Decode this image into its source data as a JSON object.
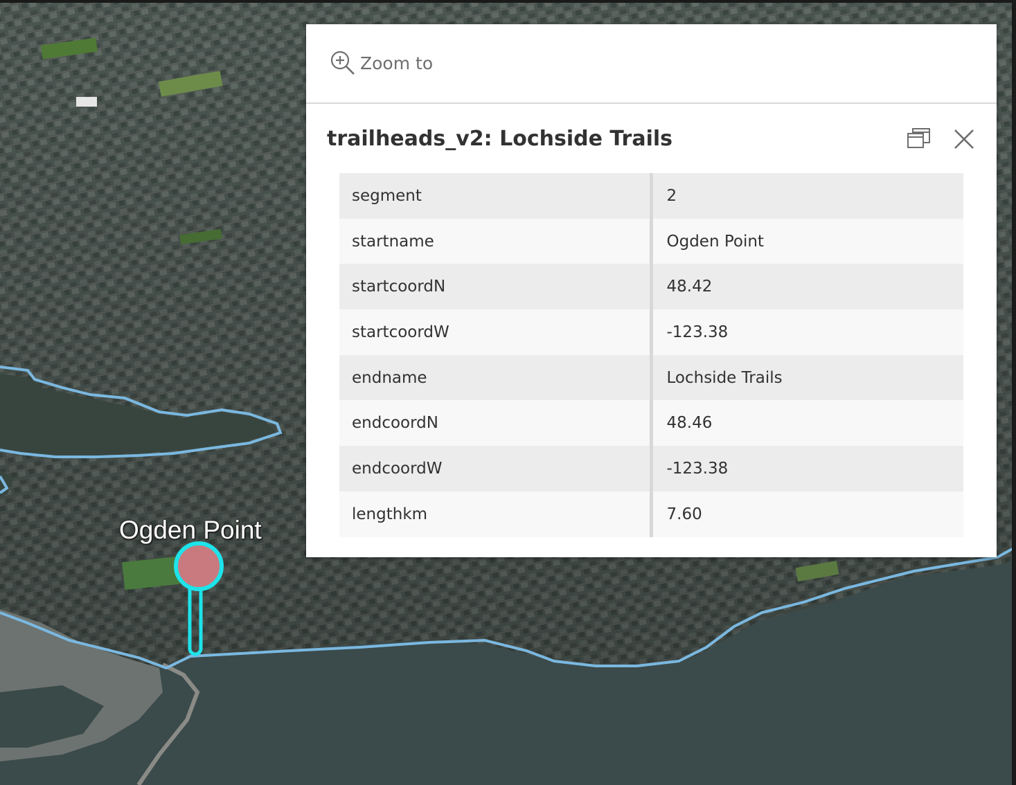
{
  "map": {
    "place_label": "Ogden Point",
    "colors": {
      "land": "#505c57",
      "water": "#3b4a4a",
      "trail": "#7ab8e0",
      "marker_fill": "#c97a7e",
      "marker_outline": "#1ee3ea"
    }
  },
  "popup": {
    "zoom_to_label": "Zoom to",
    "zoom_icon": "zoom-in-icon",
    "title": "trailheads_v2: Lochside Trails",
    "dock_icon": "dock-icon",
    "close_icon": "close-icon",
    "attributes": [
      {
        "field": "segment",
        "value": "2"
      },
      {
        "field": "startname",
        "value": "Ogden Point"
      },
      {
        "field": "startcoordN",
        "value": "48.42"
      },
      {
        "field": "startcoordW",
        "value": "-123.38"
      },
      {
        "field": "endname",
        "value": "Lochside Trails"
      },
      {
        "field": "endcoordN",
        "value": "48.46"
      },
      {
        "field": "endcoordW",
        "value": "-123.38"
      },
      {
        "field": "lengthkm",
        "value": "7.60"
      }
    ]
  }
}
